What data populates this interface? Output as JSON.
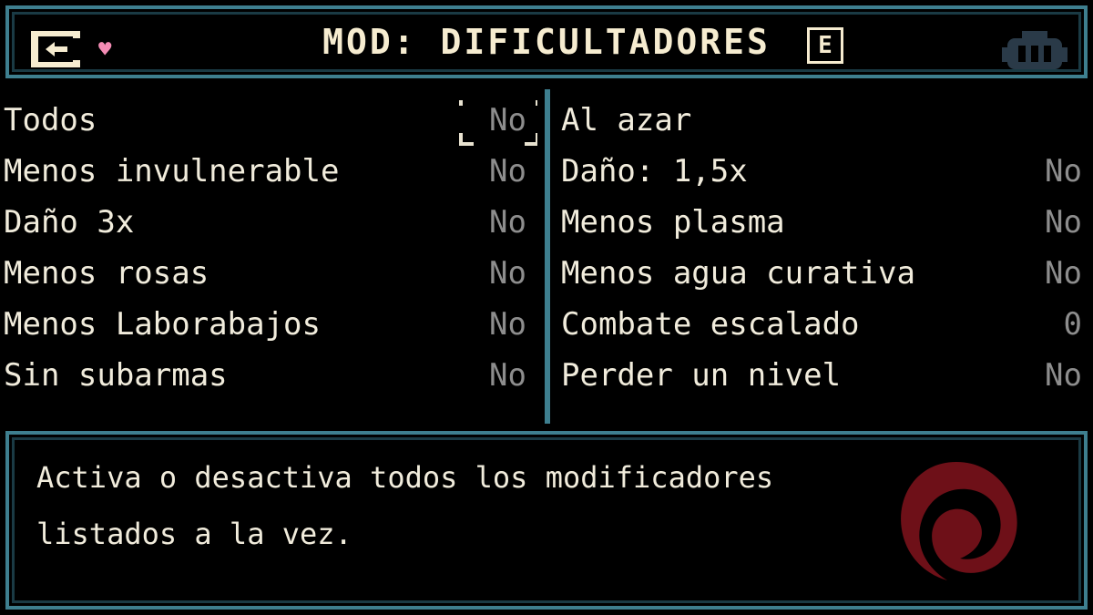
{
  "header": {
    "title": "MOD: DIFICULTADORES",
    "key_hint": "E",
    "back_icon": "exit-door-icon",
    "heart_icon": "heart-icon",
    "robot_icon": "robot-icon"
  },
  "left_options": [
    {
      "label": "Todos",
      "value": "No",
      "selected": true
    },
    {
      "label": "Menos invulnerable",
      "value": "No"
    },
    {
      "label": "Daño 3x",
      "value": "No"
    },
    {
      "label": "Menos rosas",
      "value": "No"
    },
    {
      "label": "Menos Laborabajos",
      "value": "No"
    },
    {
      "label": "Sin subarmas",
      "value": "No"
    }
  ],
  "right_options": [
    {
      "label": "Al azar",
      "value": ""
    },
    {
      "label": "Daño: 1,5x",
      "value": "No"
    },
    {
      "label": "Menos plasma",
      "value": "No"
    },
    {
      "label": "Menos agua curativa",
      "value": "No"
    },
    {
      "label": "Combate escalado",
      "value": "0"
    },
    {
      "label": "Perder un nivel",
      "value": "No"
    }
  ],
  "description": "Activa o desactiva todos los modificadores listados a la vez.",
  "colors": {
    "frame": "#3e7f8f",
    "text": "#f1ecdc",
    "value_text": "#8d8d8d",
    "heart": "#f48cb4",
    "watermark": "#6e1018"
  }
}
